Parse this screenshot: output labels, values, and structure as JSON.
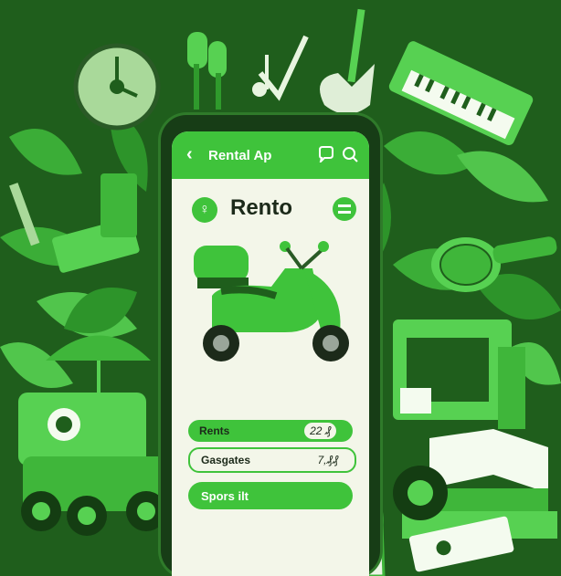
{
  "app": {
    "header_title": "Rental Ap",
    "brand_name": "Rento",
    "back_glyph": "‹",
    "brand_glyph": "♀"
  },
  "rows": [
    {
      "label": "Rents",
      "value": "22 ₰"
    },
    {
      "label": "Gasgates",
      "value": "7,₰₰"
    }
  ],
  "cta": {
    "label": "Spors ilt"
  },
  "colors": {
    "background": "#1f5e1c",
    "accent": "#3fc33b",
    "screen": "#f3f6e9",
    "foliage": "#3fb63a"
  },
  "icons": [
    "chat-icon",
    "search-icon",
    "menu-icon",
    "clock-icon",
    "guitar-icon",
    "keyboard-icon",
    "microphone-icon",
    "car-icon",
    "book-icon",
    "umbrella-icon",
    "pointing-hand-icon",
    "music-note-icon",
    "check-icon"
  ]
}
